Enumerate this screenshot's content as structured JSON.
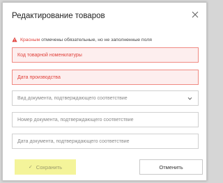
{
  "dialog": {
    "title": "Редактирование товаров",
    "close_icon": "close-icon"
  },
  "notice": {
    "icon": "warning-triangle-icon",
    "required_word": "Красным",
    "text": "отмечены обязательные, но не заполненные поля"
  },
  "fields": [
    {
      "placeholder": "Код товарной номенклатуры",
      "required": true
    },
    {
      "placeholder": "Дата производства",
      "required": true
    },
    {
      "placeholder": "Вид документа, подтверждающего соответствие",
      "required": false,
      "dropdown": true
    },
    {
      "placeholder": "Номер документа, подтверждающего соответствие",
      "required": false
    },
    {
      "placeholder": "Дата документа, подтверждающего соответствие",
      "required": false
    }
  ],
  "buttons": {
    "save_label": "Сохранить",
    "cancel_label": "Отменить"
  },
  "colors": {
    "required_accent": "#e0403a",
    "required_bg": "#fdeeee",
    "save_bg": "#f4f49a"
  }
}
